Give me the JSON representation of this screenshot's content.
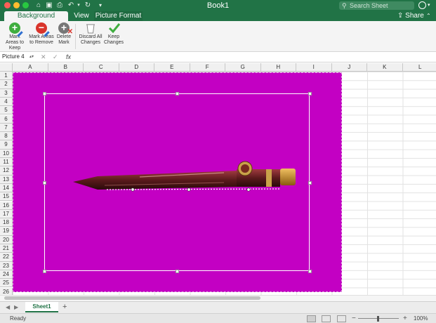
{
  "window": {
    "title": "Book1"
  },
  "search": {
    "placeholder": "Search Sheet"
  },
  "tabs": [
    {
      "label": "Background Removal"
    },
    {
      "label": "View"
    },
    {
      "label": "Picture Format"
    }
  ],
  "share_label": "Share",
  "ribbon": {
    "mark_keep": "Mark Areas to Keep",
    "mark_remove": "Mark Areas to Remove",
    "delete_mark": "Delete Mark",
    "discard": "Discard All Changes",
    "keep_changes": "Keep Changes"
  },
  "formula_bar": {
    "name_box": "Picture 4",
    "fx": "fx",
    "cancel_glyph": "✕",
    "enter_glyph": "✓"
  },
  "columns": [
    "A",
    "B",
    "C",
    "D",
    "E",
    "F",
    "G",
    "H",
    "I",
    "J",
    "K",
    "L"
  ],
  "rows": [
    "1",
    "2",
    "3",
    "4",
    "5",
    "6",
    "7",
    "8",
    "9",
    "10",
    "11",
    "12",
    "13",
    "14",
    "15",
    "16",
    "17",
    "18",
    "19",
    "20",
    "21",
    "22",
    "23",
    "24",
    "25",
    "26"
  ],
  "sheet_tab": "Sheet1",
  "add_sheet_glyph": "+",
  "status": {
    "ready": "Ready",
    "zoom": "100%",
    "zoom_minus": "−",
    "zoom_plus": "+"
  },
  "colors": {
    "accent": "#217346",
    "removed_area": "#c300c3"
  }
}
